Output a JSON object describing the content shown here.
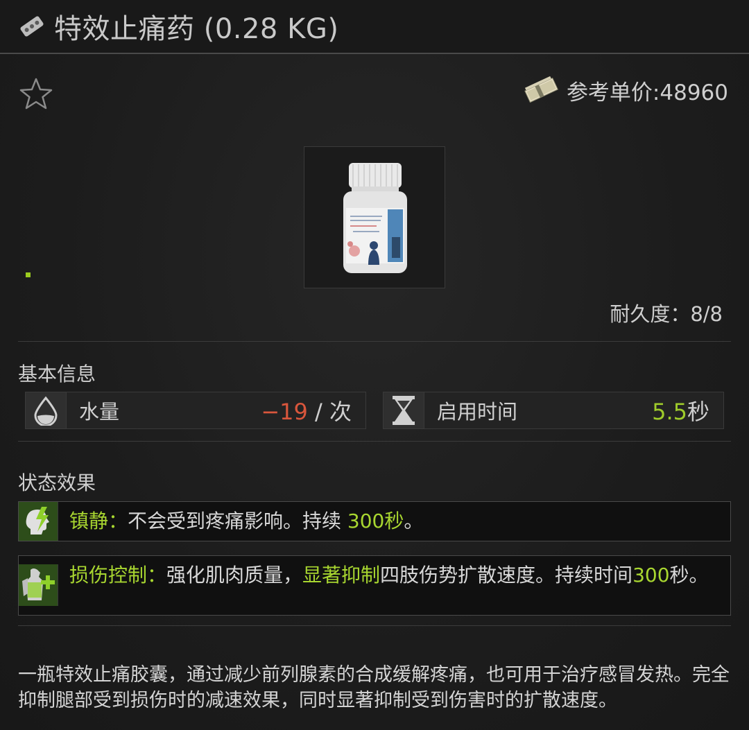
{
  "header": {
    "title": "特效止痛药 (0.28 KG)",
    "icon": "pill-blister-icon"
  },
  "item": {
    "price_text": "参考单价:48960",
    "price_icon": "money-bundle-icon",
    "favorite_icon": "star-icon",
    "image_icon": "pill-bottle-icon",
    "durability": "耐久度：8/8"
  },
  "basic_info": {
    "title": "基本信息",
    "stats": [
      {
        "label": "水量",
        "value": "−19",
        "unit": " / 次",
        "value_color": "#d9563c",
        "icon": "water-drop-icon"
      },
      {
        "label": "启用时间",
        "value": "5.5",
        "unit": "秒",
        "value_color": "#9fcb2b",
        "icon": "hourglass-icon"
      }
    ]
  },
  "status_effects": {
    "title": "状态效果",
    "effects": [
      {
        "icon": "painkiller-head-icon",
        "name": "镇静：",
        "parts": [
          "不会受到疼痛影响。持续 ",
          "300秒",
          "。"
        ]
      },
      {
        "icon": "body-heal-icon",
        "name": "损伤控制：",
        "parts": [
          "强化肌肉质量，",
          "显著抑制",
          "四肢伤势扩散速度。持续时间",
          "300",
          "秒。"
        ]
      }
    ]
  },
  "description": "一瓶特效止痛胶囊，通过减少前列腺素的合成缓解疼痛，也可用于治疗感冒发热。完全抑制腿部受到损伤时的减速效果，同时显著抑制受到伤害时的扩散速度。",
  "colors": {
    "accent_green": "#a8d630",
    "negative_red": "#d9563c",
    "background": "#1e1e1e"
  }
}
